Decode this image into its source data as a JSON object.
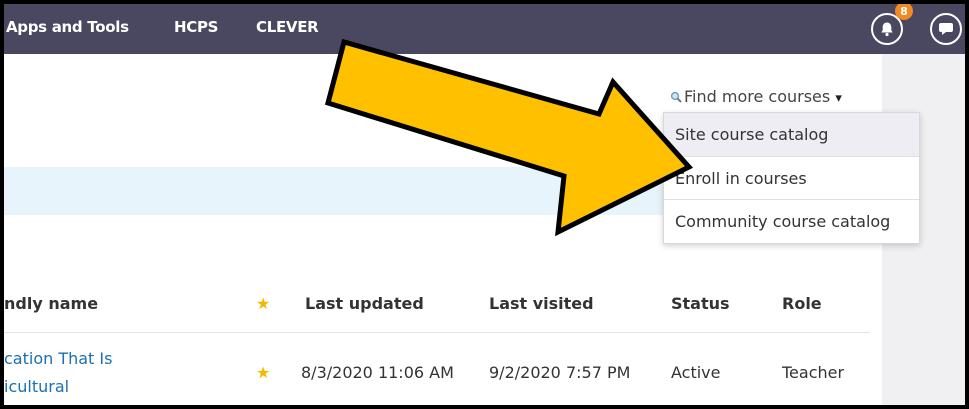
{
  "topnav": {
    "items": [
      "Apps and Tools",
      "HCPS",
      "CLEVER"
    ],
    "notification_count": "8",
    "bell_icon": "bell-icon",
    "messages_icon": "chat-bubble-icon"
  },
  "find_more": {
    "label": "Find more courses",
    "icon": "magnifier-icon",
    "caret": "▾",
    "menu": [
      "Site course catalog",
      "Enroll in courses",
      "Community course catalog"
    ]
  },
  "table": {
    "headers": {
      "name": "ndly name",
      "favorite": "★",
      "last_updated": "Last updated",
      "last_visited": "Last visited",
      "status": "Status",
      "role": "Role"
    },
    "rows": [
      {
        "name_line1": "cation That Is",
        "name_line2": "icultural",
        "favorite": "★",
        "last_updated": "8/3/2020 11:06 AM",
        "last_visited": "9/2/2020 7:57 PM",
        "status": "Active",
        "role": "Teacher"
      }
    ]
  },
  "colors": {
    "nav_bg": "#4a4760",
    "badge": "#f08a24",
    "star": "#f5b800",
    "link": "#1a6fb5",
    "arrow_fill": "#ffc000"
  }
}
